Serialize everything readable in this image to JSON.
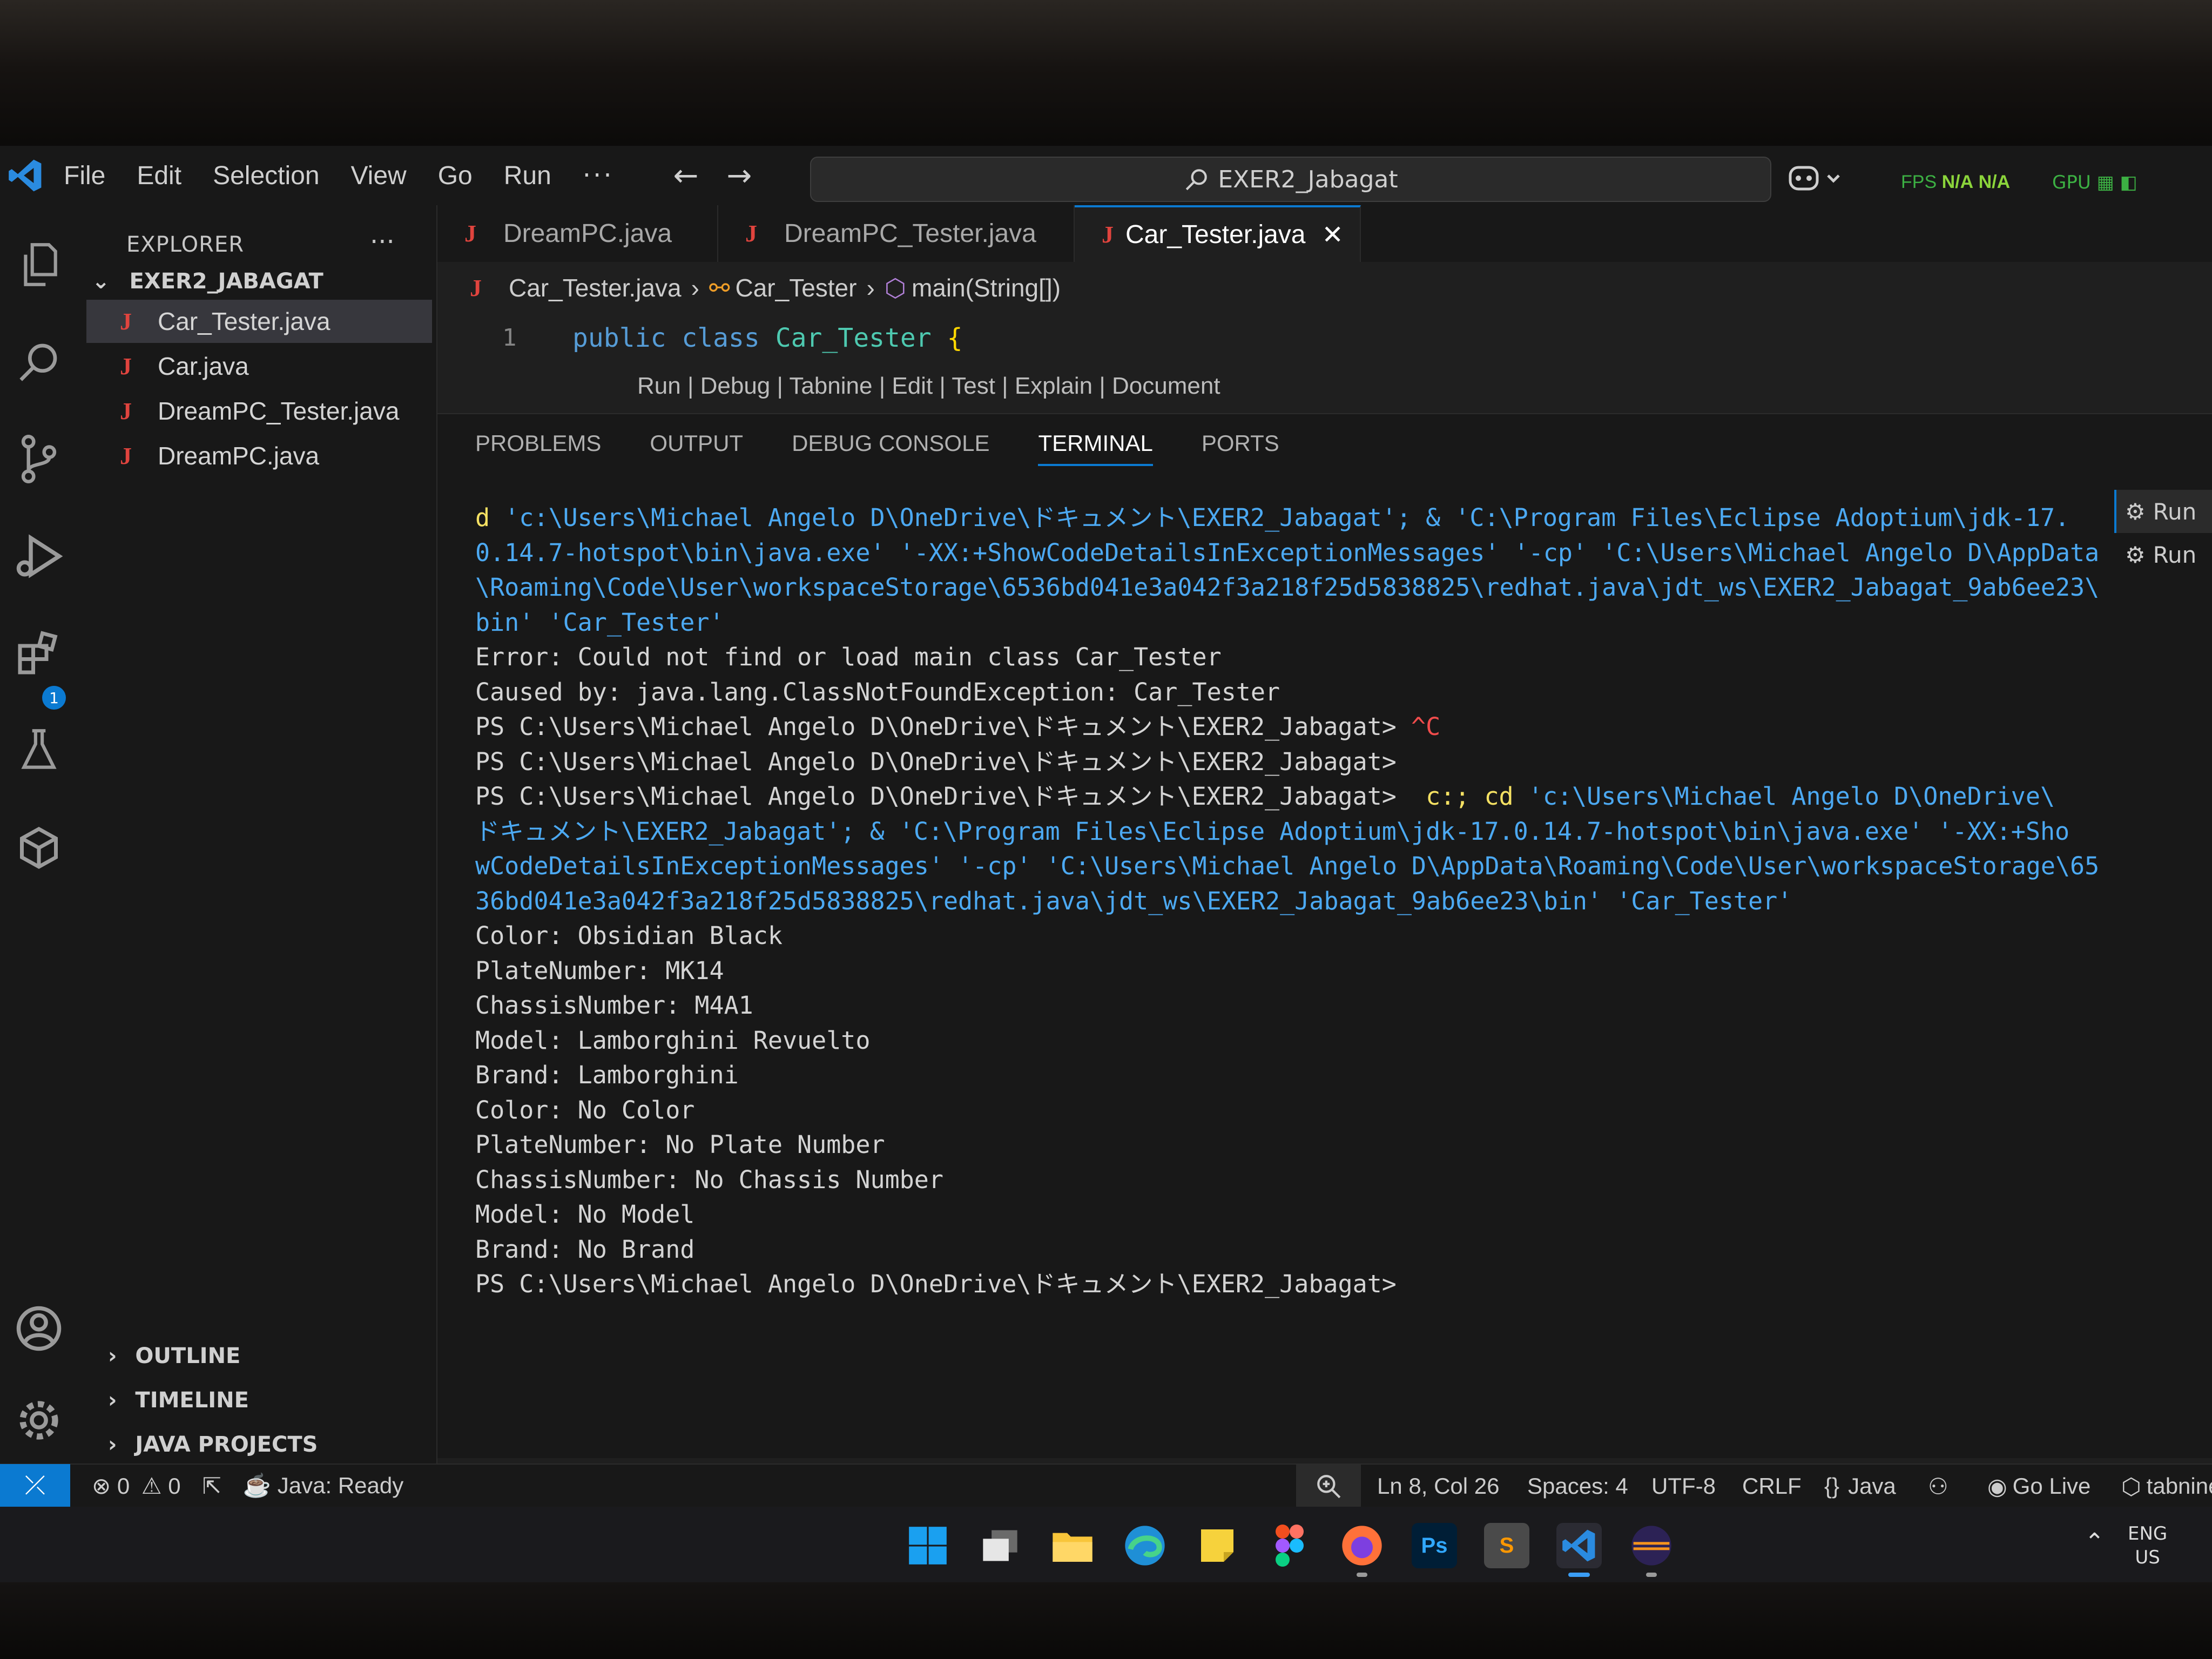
{
  "titlebar": {
    "menu": [
      "File",
      "Edit",
      "Selection",
      "View",
      "Go",
      "Run"
    ],
    "more": "···",
    "back": "←",
    "forward": "→",
    "search_text": "EXER2_Jabagat",
    "fps_label": "FPS",
    "fps_value1": "N/A",
    "fps_value2": "N/A",
    "gpu_label": "GPU"
  },
  "sidebar": {
    "title": "EXPLORER",
    "more": "···",
    "folder": "EXER2_JABAGAT",
    "files": [
      {
        "name": "Car_Tester.java",
        "active": true
      },
      {
        "name": "Car.java"
      },
      {
        "name": "DreamPC_Tester.java"
      },
      {
        "name": "DreamPC.java"
      }
    ],
    "sections": [
      "OUTLINE",
      "TIMELINE",
      "JAVA PROJECTS"
    ],
    "extensions_badge": "1"
  },
  "tabs": [
    {
      "name": "DreamPC.java"
    },
    {
      "name": "DreamPC_Tester.java"
    },
    {
      "name": "Car_Tester.java",
      "active": true
    }
  ],
  "breadcrumb": {
    "file": "Car_Tester.java",
    "class": "Car_Tester",
    "method": "main(String[])"
  },
  "code": {
    "line_number": "1",
    "kw1": "public",
    "kw2": "class",
    "class_name": "Car_Tester",
    "brace": "{",
    "codelens": "Run | Debug | Tabnine | Edit | Test | Explain | Document"
  },
  "panel": {
    "tabs": [
      "PROBLEMS",
      "OUTPUT",
      "DEBUG CONSOLE",
      "TERMINAL",
      "PORTS"
    ],
    "active_tab": "TERMINAL",
    "side_items": [
      "Run",
      "Run"
    ],
    "terminal": [
      {
        "seg": [
          {
            "t": "d ",
            "c": "yl"
          },
          {
            "t": "'c:\\Users\\Michael Angelo D\\OneDrive\\ドキュメント\\EXER2_Jabagat'; & 'C:\\Program Files\\Eclipse Adoptium\\jdk-17.",
            "c": "cmd"
          }
        ]
      },
      {
        "seg": [
          {
            "t": "0.14.7-hotspot\\bin\\java.exe' '-XX:+ShowCodeDetailsInExceptionMessages' '-cp' 'C:\\Users\\Michael Angelo D\\AppData",
            "c": "cmd"
          }
        ]
      },
      {
        "seg": [
          {
            "t": "\\Roaming\\Code\\User\\workspaceStorage\\6536bd041e3a042f3a218f25d5838825\\redhat.java\\jdt_ws\\EXER2_Jabagat_9ab6ee23\\",
            "c": "cmd"
          }
        ]
      },
      {
        "seg": [
          {
            "t": "bin' 'Car_Tester'",
            "c": "cmd"
          }
        ]
      },
      {
        "seg": [
          {
            "t": "Error: Could not find or load main class Car_Tester",
            "c": ""
          }
        ]
      },
      {
        "seg": [
          {
            "t": "Caused by: java.lang.ClassNotFoundException: Car_Tester",
            "c": ""
          }
        ]
      },
      {
        "seg": [
          {
            "t": "PS C:\\Users\\Michael Angelo D\\OneDrive\\ドキュメント\\EXER2_Jabagat> ",
            "c": ""
          },
          {
            "t": "^C",
            "c": "rd"
          }
        ]
      },
      {
        "seg": [
          {
            "t": "PS C:\\Users\\Michael Angelo D\\OneDrive\\ドキュメント\\EXER2_Jabagat>",
            "c": ""
          }
        ]
      },
      {
        "seg": [
          {
            "t": "PS C:\\Users\\Michael Angelo D\\OneDrive\\ドキュメント\\EXER2_Jabagat>  ",
            "c": ""
          },
          {
            "t": "c:; cd ",
            "c": "yl"
          },
          {
            "t": "'c:\\Users\\Michael Angelo D\\OneDrive\\",
            "c": "cmd"
          }
        ]
      },
      {
        "seg": [
          {
            "t": "ドキュメント\\EXER2_Jabagat'; & 'C:\\Program Files\\Eclipse Adoptium\\jdk-17.0.14.7-hotspot\\bin\\java.exe' '-XX:+Sho",
            "c": "cmd"
          }
        ]
      },
      {
        "seg": [
          {
            "t": "wCodeDetailsInExceptionMessages' '-cp' 'C:\\Users\\Michael Angelo D\\AppData\\Roaming\\Code\\User\\workspaceStorage\\65",
            "c": "cmd"
          }
        ]
      },
      {
        "seg": [
          {
            "t": "36bd041e3a042f3a218f25d5838825\\redhat.java\\jdt_ws\\EXER2_Jabagat_9ab6ee23\\bin' 'Car_Tester'",
            "c": "cmd"
          }
        ]
      },
      {
        "seg": [
          {
            "t": "Color: Obsidian Black",
            "c": ""
          }
        ]
      },
      {
        "seg": [
          {
            "t": "PlateNumber: MK14",
            "c": ""
          }
        ]
      },
      {
        "seg": [
          {
            "t": "ChassisNumber: M4A1",
            "c": ""
          }
        ]
      },
      {
        "seg": [
          {
            "t": "Model: Lamborghini Revuelto",
            "c": ""
          }
        ]
      },
      {
        "seg": [
          {
            "t": "Brand: Lamborghini",
            "c": ""
          }
        ]
      },
      {
        "seg": [
          {
            "t": "Color: No Color",
            "c": ""
          }
        ]
      },
      {
        "seg": [
          {
            "t": "PlateNumber: No Plate Number",
            "c": ""
          }
        ]
      },
      {
        "seg": [
          {
            "t": "ChassisNumber: No Chassis Number",
            "c": ""
          }
        ]
      },
      {
        "seg": [
          {
            "t": "Model: No Model",
            "c": ""
          }
        ]
      },
      {
        "seg": [
          {
            "t": "Brand: No Brand",
            "c": ""
          }
        ]
      },
      {
        "seg": [
          {
            "t": "PS C:\\Users\\Michael Angelo D\\OneDrive\\ドキュメント\\EXER2_Jabagat>",
            "c": ""
          }
        ]
      }
    ]
  },
  "statusbar": {
    "errors": "0",
    "warnings": "0",
    "java_status": "Java: Ready",
    "position": "Ln 8, Col 26",
    "spaces": "Spaces: 4",
    "encoding": "UTF-8",
    "eol": "CRLF",
    "language": "Java",
    "language_icon": "{}",
    "go_live": "Go Live",
    "tabnine": "tabnine"
  },
  "taskbar": {
    "apps": [
      "windows-start",
      "task-view",
      "file-explorer",
      "edge",
      "sticky-notes",
      "figma",
      "firefox",
      "photoshop",
      "sublime-text",
      "vscode",
      "eclipse"
    ],
    "photoshop_label": "Ps",
    "sublime_label": "S",
    "lang_line1": "ENG",
    "lang_line2": "US"
  },
  "colors": {
    "accent": "#0b7ad1",
    "java_icon": "#e0443e",
    "terminal_command": "#4ca9f2",
    "terminal_yellow": "#f5e163",
    "fps_green": "#3cb043"
  }
}
